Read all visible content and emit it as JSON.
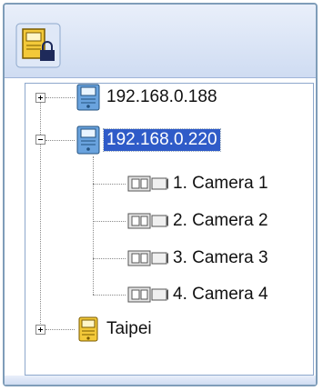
{
  "colors": {
    "selection": "#2f5bc8",
    "server_blue": "#4a8fd1",
    "server_yellow": "#e8c030"
  },
  "root": {
    "icon": "server-group-lock-icon"
  },
  "tree": {
    "nodes": [
      {
        "label": "192.168.0.188",
        "icon": "server-icon",
        "expander": "collapsed"
      },
      {
        "label": "192.168.0.220",
        "icon": "server-icon",
        "expander": "expanded",
        "selected": true,
        "children": [
          {
            "label": "1. Camera 1",
            "icon": "camera-icon"
          },
          {
            "label": "2. Camera 2",
            "icon": "camera-icon"
          },
          {
            "label": "3. Camera 3",
            "icon": "camera-icon"
          },
          {
            "label": "4. Camera 4",
            "icon": "camera-icon"
          }
        ]
      },
      {
        "label": "Taipei",
        "icon": "server-group-icon",
        "expander": "collapsed"
      }
    ]
  }
}
